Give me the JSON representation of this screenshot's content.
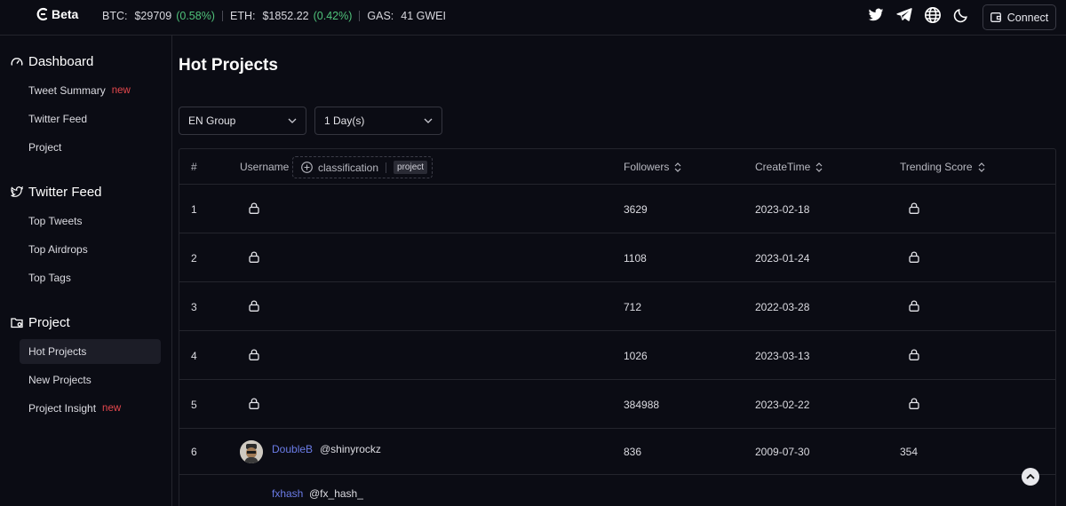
{
  "header": {
    "logo_text": "Beta",
    "btc_label": "BTC:",
    "btc_price": "$29709",
    "btc_change": "(0.58%)",
    "eth_label": "ETH:",
    "eth_price": "$1852.22",
    "eth_change": "(0.42%)",
    "gas_label": "GAS:",
    "gas_value": "41 GWEI",
    "connect_label": "Connect",
    "icons": [
      "twitter-icon",
      "telegram-icon",
      "globe-icon",
      "moon-icon"
    ]
  },
  "sidebar": {
    "sections": [
      {
        "title": "Dashboard",
        "icon": "gauge-icon",
        "items": [
          {
            "label": "Tweet Summary",
            "badge": "new"
          },
          {
            "label": "Twitter Feed"
          },
          {
            "label": "Project"
          }
        ]
      },
      {
        "title": "Twitter Feed",
        "icon": "twitter-icon",
        "items": [
          {
            "label": "Top Tweets"
          },
          {
            "label": "Top Airdrops"
          },
          {
            "label": "Top Tags"
          }
        ]
      },
      {
        "title": "Project",
        "icon": "folder-icon",
        "items": [
          {
            "label": "Hot Projects",
            "active": true
          },
          {
            "label": "New Projects"
          },
          {
            "label": "Project Insight",
            "badge": "new"
          }
        ]
      }
    ]
  },
  "main": {
    "title": "Hot Projects",
    "filters": {
      "group": "EN Group",
      "period": "1 Day(s)"
    },
    "table": {
      "columns": {
        "index": "#",
        "username": "Username",
        "classification": "classification",
        "class_tag": "project",
        "followers": "Followers",
        "create_time": "CreateTime",
        "trending_score": "Trending Score"
      },
      "rows": [
        {
          "index": "1",
          "followers": "3629",
          "create_time": "2023-02-18",
          "locked": true
        },
        {
          "index": "2",
          "followers": "1108",
          "create_time": "2023-01-24",
          "locked": true
        },
        {
          "index": "3",
          "followers": "712",
          "create_time": "2022-03-28",
          "locked": true
        },
        {
          "index": "4",
          "followers": "1026",
          "create_time": "2023-03-13",
          "locked": true
        },
        {
          "index": "5",
          "followers": "384988",
          "create_time": "2023-02-22",
          "locked": true
        },
        {
          "index": "6",
          "name": "DoubleB",
          "handle": "@shinyrockz",
          "followers": "836",
          "create_time": "2009-07-30",
          "score": "354",
          "locked": false
        },
        {
          "name": "fxhash",
          "handle": "@fx_hash_"
        }
      ]
    }
  },
  "colors": {
    "accent_green": "#4fc27a",
    "badge_red": "#e5484d",
    "link_blue": "#6b7ce8",
    "background": "#0b0c14"
  }
}
